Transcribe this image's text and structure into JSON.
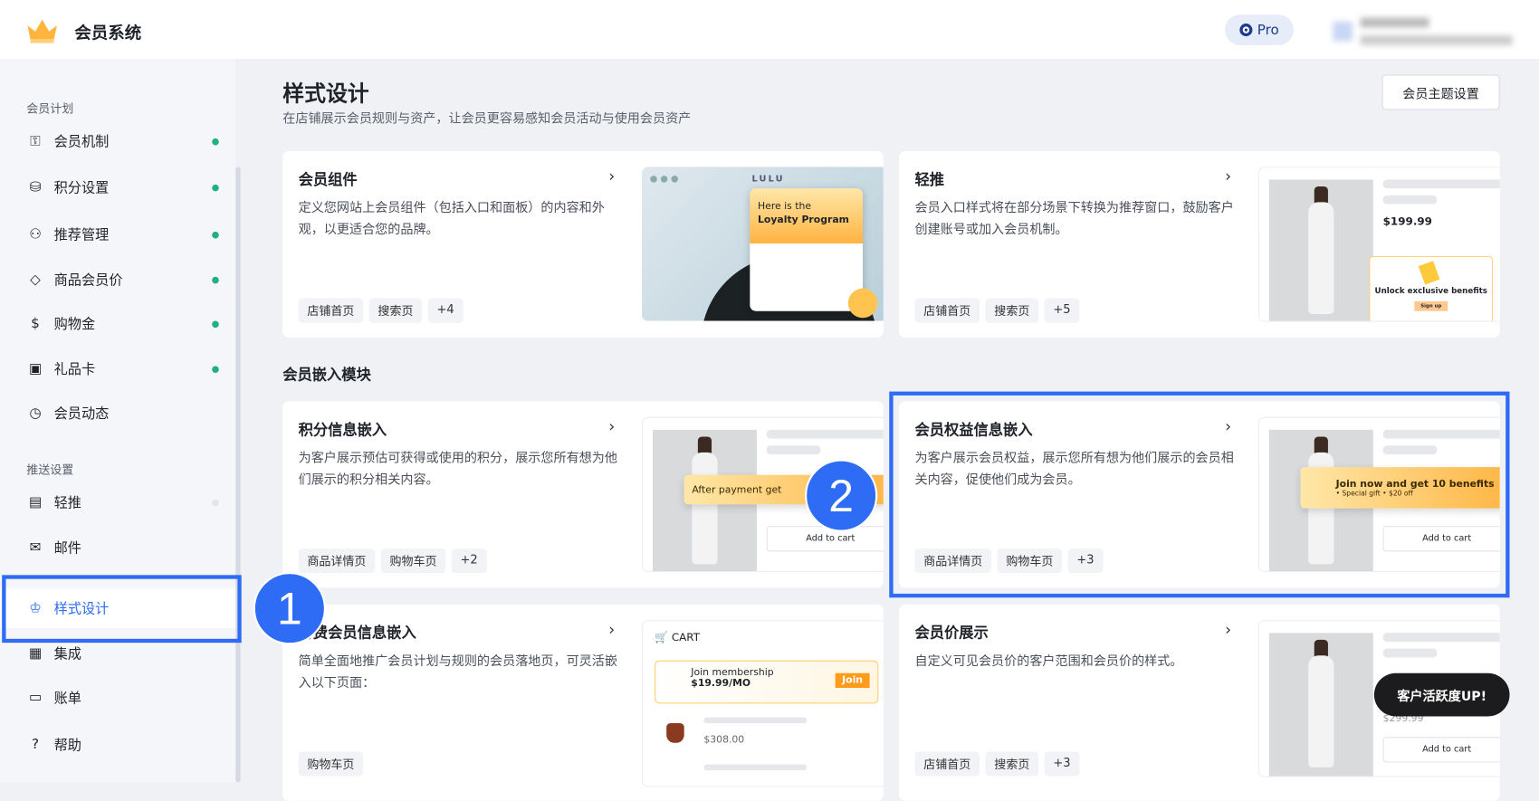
{
  "header": {
    "app_title": "会员系统",
    "plan_badge": "Pro"
  },
  "sidebar": {
    "group1": "会员计划",
    "group2": "推送设置",
    "items": [
      {
        "label": "会员机制",
        "icon": "member-card-icon",
        "status": "on"
      },
      {
        "label": "积分设置",
        "icon": "coins-icon",
        "status": "on"
      },
      {
        "label": "推荐管理",
        "icon": "user-add-icon",
        "status": "on"
      },
      {
        "label": "商品会员价",
        "icon": "tag-icon",
        "status": "on"
      },
      {
        "label": "购物金",
        "icon": "money-bag-icon",
        "status": "on"
      },
      {
        "label": "礼品卡",
        "icon": "gift-card-icon",
        "status": "on"
      },
      {
        "label": "会员动态",
        "icon": "clock-icon"
      },
      {
        "label": "轻推",
        "icon": "window-icon",
        "status": "off"
      },
      {
        "label": "邮件",
        "icon": "mail-icon"
      },
      {
        "label": "样式设计",
        "icon": "crown-icon",
        "active": true
      },
      {
        "label": "集成",
        "icon": "grid-icon"
      },
      {
        "label": "账单",
        "icon": "wallet-icon"
      },
      {
        "label": "帮助",
        "icon": "help-icon"
      }
    ]
  },
  "main": {
    "title": "样式设计",
    "subtitle": "在店铺展示会员规则与资产，让会员更容易感知会员活动与使用会员资产",
    "theme_button": "会员主题设置",
    "section_embed": "会员嵌入模块",
    "cards": [
      {
        "title": "会员组件",
        "desc": "定义您网站上会员组件（包括入口和面板）的内容和外观，以更适合您的品牌。",
        "tags": [
          "店铺首页",
          "搜索页",
          "+4"
        ],
        "preview": {
          "brand": "LULU",
          "line1": "Here is the",
          "line2": "Loyalty Program"
        }
      },
      {
        "title": "轻推",
        "desc": "会员入口样式将在部分场景下转换为推荐窗口，鼓励客户创建账号或加入会员机制。",
        "tags": [
          "店铺首页",
          "搜索页",
          "+5"
        ],
        "preview": {
          "price": "$199.99",
          "popup": "Unlock exclusive benefits",
          "btn": "Sign up"
        }
      },
      {
        "title": "积分信息嵌入",
        "desc": "为客户展示预估可获得或使用的积分，展示您所有想为他们展示的积分相关内容。",
        "tags": [
          "商品详情页",
          "购物车页",
          "+2"
        ],
        "preview": {
          "banner": "After payment get",
          "cart": "Add to cart"
        }
      },
      {
        "title": "会员权益信息嵌入",
        "desc": "为客户展示会员权益，展示您所有想为他们展示的会员相关内容，促使他们成为会员。",
        "tags": [
          "商品详情页",
          "购物车页",
          "+3"
        ],
        "preview": {
          "banner": "Join now and get 10 benefits",
          "sub": "• Special gift  • $20 off",
          "cart": "Add to cart"
        }
      },
      {
        "title": "付费会员信息嵌入",
        "desc": "简单全面地推广会员计划与规则的会员落地页，可灵活嵌入以下页面：",
        "tags": [
          "购物车页"
        ],
        "preview": {
          "cart": "CART",
          "join_title": "Join membership",
          "join_price": "$19.99/MO",
          "join_btn": "Join",
          "price": "$308.00"
        }
      },
      {
        "title": "会员价展示",
        "desc": "自定义可见会员价的客户范围和会员价的样式。",
        "tags": [
          "店铺首页",
          "搜索页",
          "+3"
        ],
        "preview": {
          "price": "$299.99",
          "cart": "Add to cart"
        }
      }
    ]
  },
  "annotations": {
    "step1": "1",
    "step2": "2"
  },
  "float_pill": "客户活跃度UP!"
}
